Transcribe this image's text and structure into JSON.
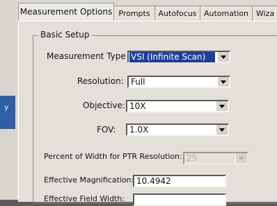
{
  "tabs": [
    {
      "label": "Measurement Options",
      "active": true
    },
    {
      "label": "Prompts"
    },
    {
      "label": "Autofocus"
    },
    {
      "label": "Automation"
    },
    {
      "label": "Wiza"
    }
  ],
  "left_panel": {
    "glyph": "y"
  },
  "basic_setup": {
    "title": "Basic Setup",
    "measurement_type": {
      "label": "Measurement Type",
      "value": "VSI (Infinite Scan)"
    },
    "resolution": {
      "label": "Resolution:",
      "value": "Full"
    },
    "objective": {
      "label": "Objective:",
      "value": "10X"
    },
    "fov": {
      "label": "FOV:",
      "value": "1.0X"
    },
    "ptr": {
      "label": "Percent of Width for PTR Resolution:",
      "value": "25"
    },
    "effective_magnification": {
      "label": "Effective Magnification:",
      "value": "10.4942"
    },
    "effective_field": {
      "label": "Effective Field Width:",
      "value": ""
    }
  }
}
